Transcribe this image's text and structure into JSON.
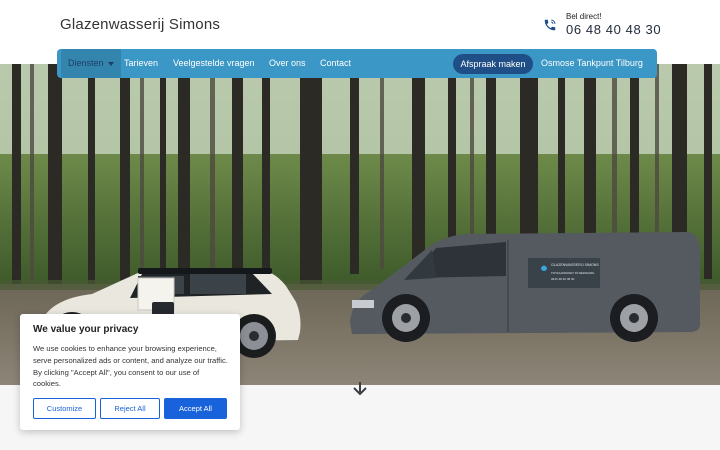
{
  "header": {
    "brand": "Glazenwasserij Simons",
    "phone_caption": "Bel direct!",
    "phone_number": "06 48 40 48 30"
  },
  "nav": {
    "items": [
      "Diensten",
      "Tarieven",
      "Veelgestelde vragen",
      "Over ons",
      "Contact"
    ],
    "cta": "Afspraak maken",
    "extra": "Osmose Tankpunt Tilburg"
  },
  "hero": {
    "van_decal": "GLAZENWASSERIJ SIMONS",
    "van_decal_sub": "TOTAALPAKKET IN REINIGING",
    "van_decal_phone": "0615 48 40 48 30"
  },
  "cookie": {
    "title": "We value your privacy",
    "text": "We use cookies to enhance your browsing experience, serve personalized ads or content, and analyze our traffic. By clicking \"Accept All\", you consent to our use of cookies.",
    "customize": "Customize",
    "reject": "Reject All",
    "accept": "Accept All"
  },
  "icons": {
    "phone": "phone-icon",
    "caret": "caret-down-icon",
    "scroll": "arrow-down-icon"
  },
  "colors": {
    "nav_bg": "#3b97c5",
    "cta_bg": "#1f4f86",
    "cookie_accent": "#1863dc"
  }
}
